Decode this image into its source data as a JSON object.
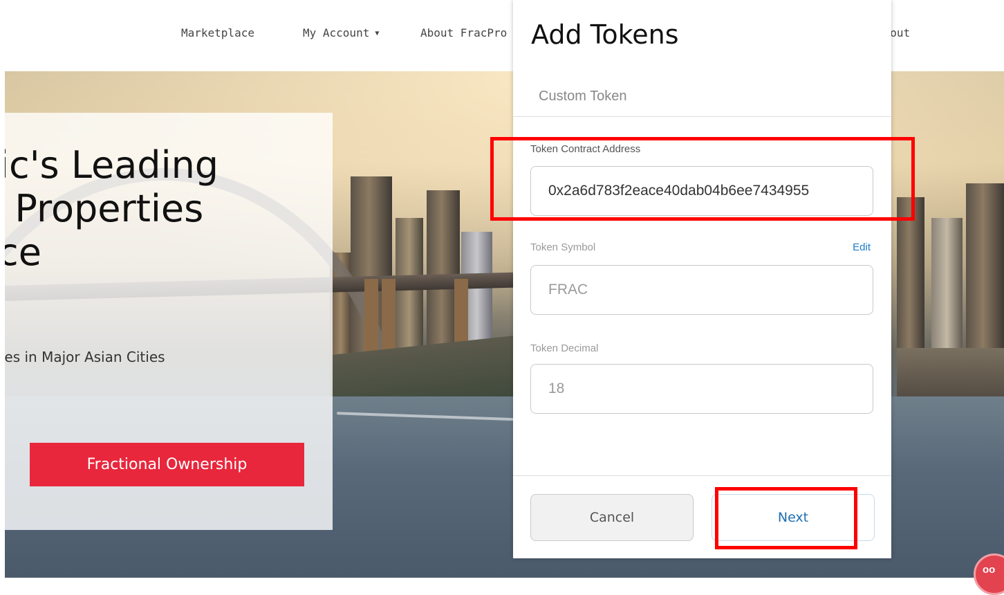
{
  "nav": {
    "items": [
      {
        "label": "Marketplace"
      },
      {
        "label": "My Account"
      },
      {
        "label": "About FracPro"
      },
      {
        "label": "ogout"
      }
    ]
  },
  "hero": {
    "title_lines": [
      "fic's Leading",
      ". Properties",
      "ce"
    ],
    "subtitle": "ties in Major Asian Cities",
    "cta_label": "Fractional Ownership"
  },
  "modal": {
    "title": "Add Tokens",
    "tab_label": "Custom Token",
    "contract_label": "Token Contract Address",
    "contract_value": "0x2a6d783f2eace40dab04b6ee7434955",
    "symbol_label": "Token Symbol",
    "symbol_edit": "Edit",
    "symbol_value": "FRAC",
    "decimal_label": "Token Decimal",
    "decimal_value": "18",
    "cancel_label": "Cancel",
    "next_label": "Next"
  },
  "chat": {
    "badge_text": "oo"
  }
}
